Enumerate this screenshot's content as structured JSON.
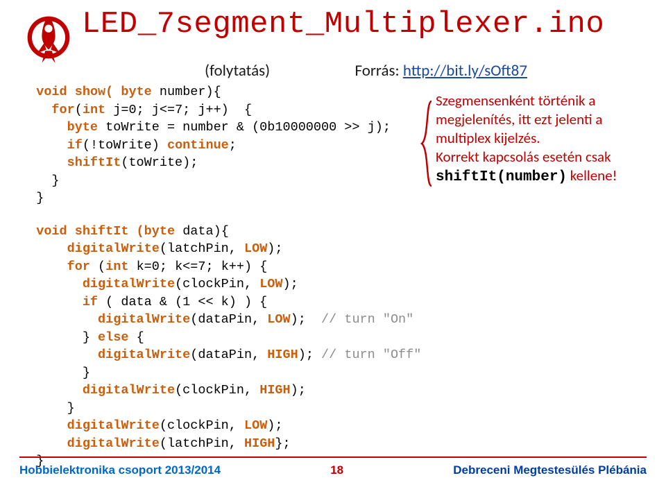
{
  "header": {
    "title": "LED_7segment_Multiplexer.ino",
    "subtitle": "(folytatás)",
    "source_label": "Forrás: ",
    "source_link": "http://bit.ly/sOft87"
  },
  "code": {
    "show_fn": {
      "sig_void": "void",
      "sig_name": " show( ",
      "sig_byte": "byte",
      "sig_rest": " number){",
      "l2_for": "for",
      "l2_int": "int",
      "l2_rest": " j=0; j<=7; j++)  {",
      "l3_byte": "byte",
      "l3_rest": " toWrite = number & (0b10000000 >> j);",
      "l4_if": "if",
      "l4_rest": "(!toWrite) ",
      "l4_cont": "continue",
      "l4_semi": ";",
      "l5_call": "shiftIt",
      "l5_rest": "(toWrite);",
      "l6": "}",
      "l7": "}"
    },
    "shift_fn": {
      "sig_void": "void",
      "sig_name": " shiftIt (",
      "sig_byte": "byte",
      "sig_rest": " data){",
      "l2_fn": "digitalWrite",
      "l2_rest": "(latchPin, ",
      "l2_low": "LOW",
      "l2_end": ");",
      "l3_for": "for",
      "l3_rest": " (",
      "l3_int": "int",
      "l3_rest2": " k=0; k<=7; k++) {",
      "l4_fn": "digitalWrite",
      "l4_rest": "(clockPin, ",
      "l4_low": "LOW",
      "l4_end": ");",
      "l5_if": "if",
      "l5_rest": " ( data & (1 << k) ) {",
      "l6_fn": "digitalWrite",
      "l6_rest": "(dataPin, ",
      "l6_low": "LOW",
      "l6_end": ");  ",
      "l6_cmt": "// turn \"On\"",
      "l7_else": "else",
      "l7_rest": " {",
      "l7_close": "} ",
      "l8_fn": "digitalWrite",
      "l8_rest": "(dataPin, ",
      "l8_high": "HIGH",
      "l8_end": "); ",
      "l8_cmt": "// turn \"Off\"",
      "l9": "}",
      "l10_fn": "digitalWrite",
      "l10_rest": "(clockPin, ",
      "l10_high": "HIGH",
      "l10_end": ");",
      "l11": "}",
      "l12_fn": "digitalWrite",
      "l12_rest": "(clockPin, ",
      "l12_low": "LOW",
      "l12_end": ");",
      "l13_fn": "digitalWrite",
      "l13_rest": "(latchPin, ",
      "l13_high": "HIGH",
      "l13_end": "};",
      "l14": "}"
    }
  },
  "note": {
    "line1": "Szegmensenként történik a megjelenítés, itt ezt jelenti  a multiplex kijelzés.",
    "line2a": "Korrekt kapcsolás esetén csak ",
    "line2mono": "shiftIt(number)",
    "line2b": " kellene!"
  },
  "footer": {
    "left": "Hobbielektronika csoport 2013/2014",
    "page": "18",
    "right": "Debreceni Megtestesülés Plébánia"
  }
}
